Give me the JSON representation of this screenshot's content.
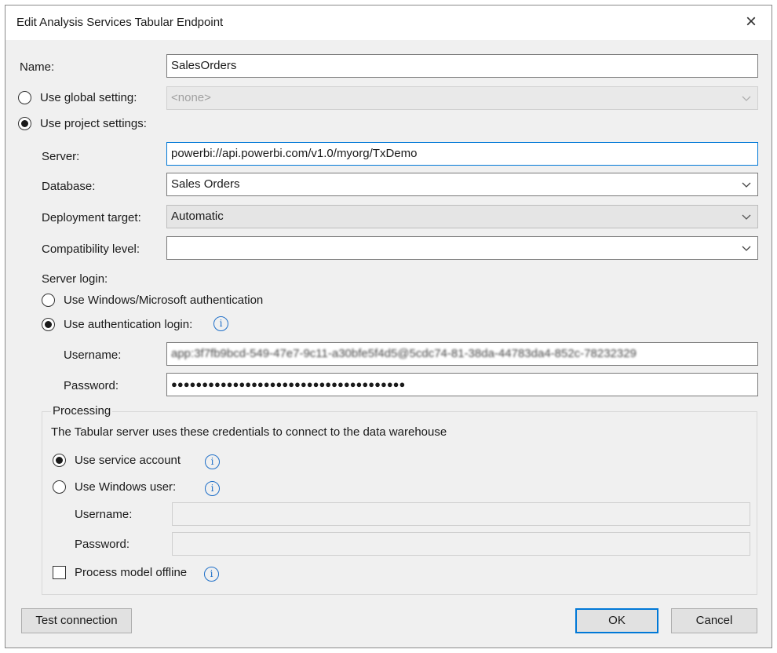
{
  "window": {
    "title": "Edit Analysis Services Tabular Endpoint"
  },
  "name": {
    "label": "Name:",
    "value": "SalesOrders"
  },
  "use_global": {
    "label": "Use global setting:",
    "value": "<none>",
    "selected": false
  },
  "use_project": {
    "label": "Use project settings:",
    "selected": true
  },
  "server": {
    "label": "Server:",
    "value": "powerbi://api.powerbi.com/v1.0/myorg/TxDemo"
  },
  "database": {
    "label": "Database:",
    "value": "Sales Orders"
  },
  "deployment_target": {
    "label": "Deployment target:",
    "value": "Automatic"
  },
  "compatibility_level": {
    "label": "Compatibility level:",
    "value": ""
  },
  "server_login": {
    "label": "Server login:",
    "windows_auth_label": "Use Windows/Microsoft authentication",
    "auth_login_label": "Use authentication login:",
    "selected": "auth_login",
    "username_label": "Username:",
    "username_value": "app:3f7fb9bcd-549-47e7-9c11-a30bfe5f4d5@5cdc74-81-38da-44783da4-852c-78232329",
    "password_label": "Password:",
    "password_value": "●●●●●●●●●●●●●●●●●●●●●●●●●●●●●●●●●●●●●●"
  },
  "processing": {
    "title": "Processing",
    "description": "The Tabular server uses these credentials to connect to the data warehouse",
    "service_account_label": "Use service account",
    "windows_user_label": "Use Windows user:",
    "selected": "service_account",
    "username_label": "Username:",
    "username_value": "",
    "password_label": "Password:",
    "password_value": "",
    "offline_label": "Process model offline",
    "offline_checked": false
  },
  "buttons": {
    "test_connection": "Test connection",
    "ok": "OK",
    "cancel": "Cancel"
  },
  "icons": {
    "close": "×",
    "info": "i"
  },
  "colors": {
    "accent": "#0078d7",
    "info": "#1e6fc8"
  }
}
